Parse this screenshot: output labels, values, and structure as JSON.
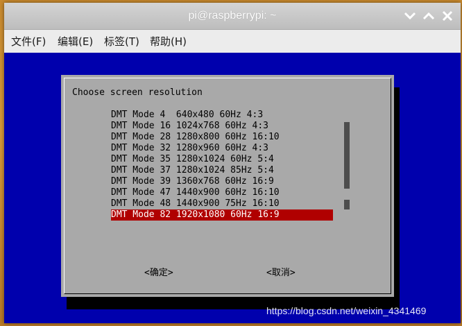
{
  "window": {
    "title": "pi@raspberrypi: ~"
  },
  "menubar": {
    "items": [
      {
        "label": "文件(F)"
      },
      {
        "label": "编辑(E)"
      },
      {
        "label": "标签(T)"
      },
      {
        "label": "帮助(H)"
      }
    ]
  },
  "dialog": {
    "title": "Choose screen resolution",
    "options": [
      "DMT Mode 4  640x480 60Hz 4:3",
      "DMT Mode 16 1024x768 60Hz 4:3",
      "DMT Mode 28 1280x800 60Hz 16:10",
      "DMT Mode 32 1280x960 60Hz 4:3",
      "DMT Mode 35 1280x1024 60Hz 5:4",
      "DMT Mode 37 1280x1024 85Hz 5:4",
      "DMT Mode 39 1360x768 60Hz 16:9",
      "DMT Mode 47 1440x900 60Hz 16:10",
      "DMT Mode 48 1440x900 75Hz 16:10",
      "DMT Mode 82 1920x1080 60Hz 16:9"
    ],
    "selected_option": "DMT Mode 82 1920x1080 60Hz 16:9",
    "ok_button": "<确定>",
    "cancel_button": "<取消>"
  },
  "colors": {
    "terminal_bg": "#0000ad",
    "dialog_bg": "#a9a9a9",
    "selection_bg": "#b00000"
  },
  "watermark": "https://blog.csdn.net/weixin_4341469"
}
